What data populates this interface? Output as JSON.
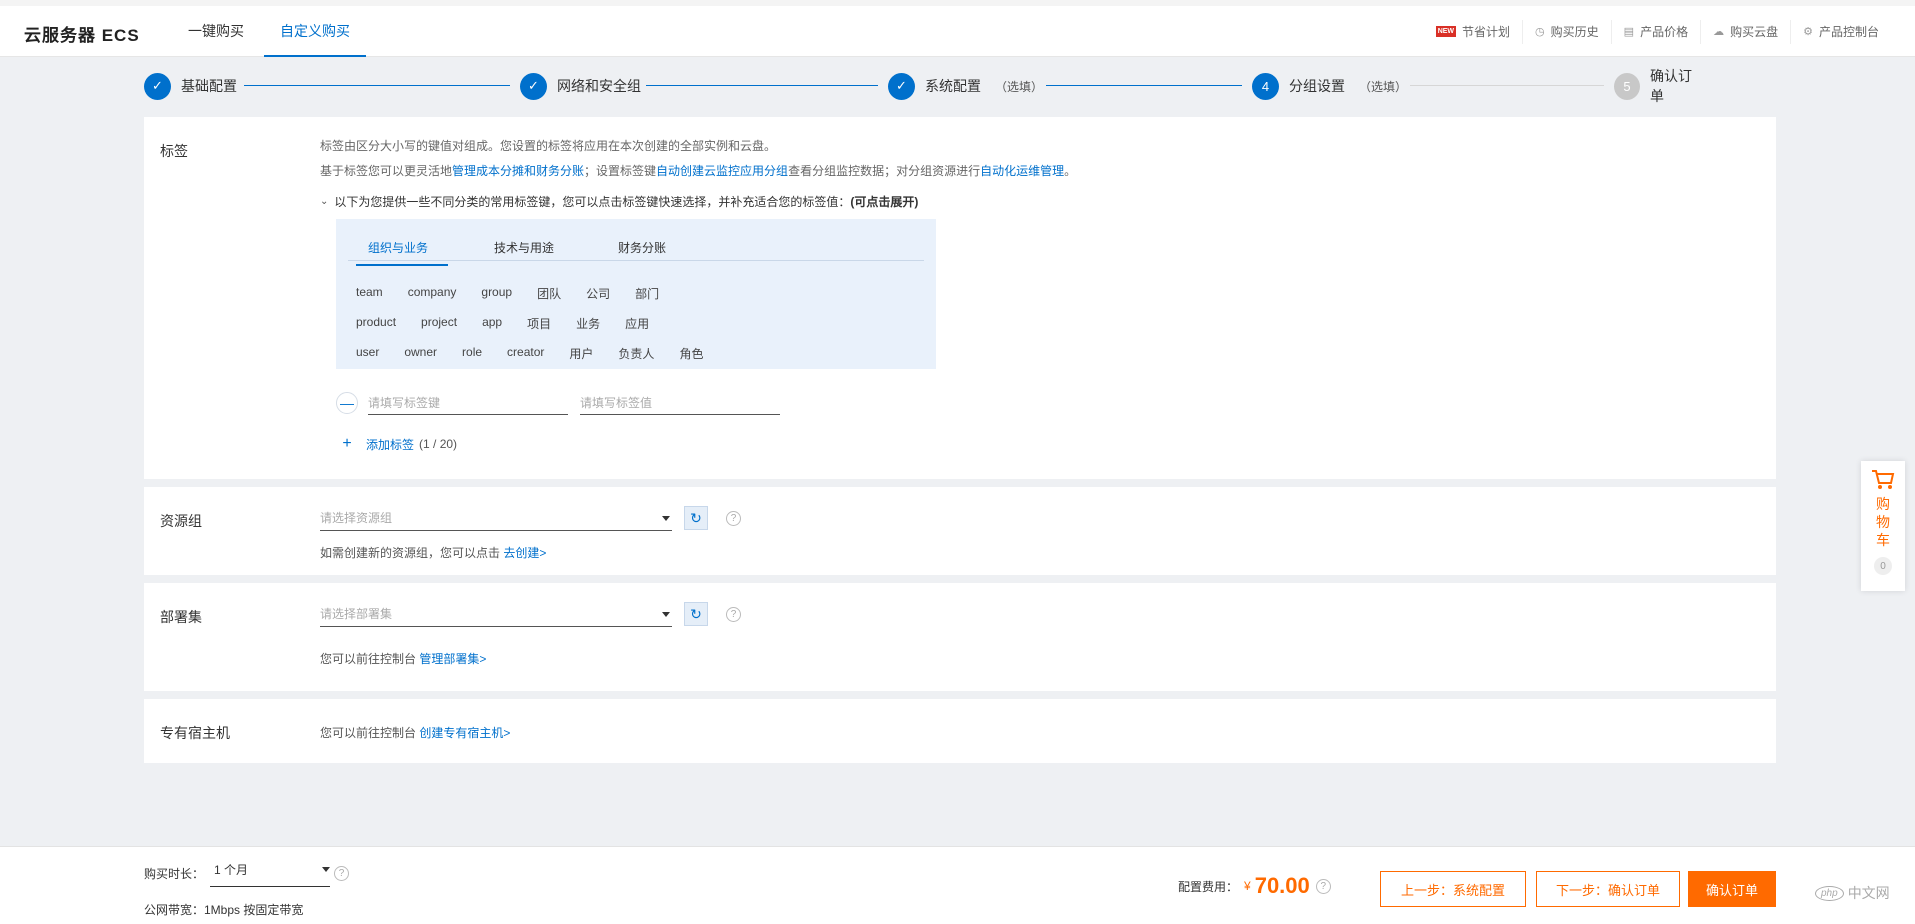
{
  "header": {
    "brand": "云服务器 ECS",
    "tabs": [
      "一键购买",
      "自定义购买"
    ],
    "right_items": [
      {
        "label": "节省计划",
        "badge": "NEW"
      },
      {
        "label": "购买历史"
      },
      {
        "label": "产品价格"
      },
      {
        "label": "购买云盘"
      },
      {
        "label": "产品控制台"
      }
    ]
  },
  "steps": [
    {
      "num": "✓",
      "label": "基础配置",
      "optional": ""
    },
    {
      "num": "✓",
      "label": "网络和安全组",
      "optional": ""
    },
    {
      "num": "✓",
      "label": "系统配置",
      "optional": "（选填）"
    },
    {
      "num": "4",
      "label": "分组设置",
      "optional": "（选填）"
    },
    {
      "num": "5",
      "label": "确认订单",
      "optional": ""
    }
  ],
  "tags": {
    "title": "标签",
    "desc1": "标签由区分大小写的键值对组成。您设置的标签将应用在本次创建的全部实例和云盘。",
    "desc2_pre": "基于标签您可以更灵活地",
    "desc2_link1": "管理成本分摊和财务分账",
    "desc2_mid1": "；设置标签键",
    "desc2_link2": "自动创建云监控应用分组",
    "desc2_mid2": "查看分组监控数据；对分组资源进行",
    "desc2_link3": "自动化运维管理",
    "desc2_end": "。",
    "expander_text": "以下为您提供一些不同分类的常用标签键，您可以点击标签键快速选择，并补充适合您的标签值：",
    "expander_bold": "(可点击展开)",
    "panel_tabs": [
      "组织与业务",
      "技术与用途",
      "财务分账"
    ],
    "chip_rows": [
      [
        "team",
        "company",
        "group",
        "团队",
        "公司",
        "部门"
      ],
      [
        "product",
        "project",
        "app",
        "项目",
        "业务",
        "应用"
      ],
      [
        "user",
        "owner",
        "role",
        "creator",
        "用户",
        "负责人",
        "角色"
      ]
    ],
    "key_placeholder": "请填写标签键",
    "value_placeholder": "请填写标签值",
    "add_label": "添加标签",
    "add_count": "(1 / 20)"
  },
  "resource_group": {
    "title": "资源组",
    "placeholder": "请选择资源组",
    "hint_pre": "如需创建新的资源组，您可以点击 ",
    "hint_link": "去创建>"
  },
  "deploy_set": {
    "title": "部署集",
    "placeholder": "请选择部署集",
    "hint_pre": "您可以前往控制台 ",
    "hint_link": "管理部署集>"
  },
  "dedicated_host": {
    "title": "专有宿主机",
    "hint_pre": "您可以前往控制台 ",
    "hint_link": "创建专有宿主机>"
  },
  "cart": {
    "label": "购物车",
    "count": "0"
  },
  "bottom": {
    "duration_label": "购买时长：",
    "duration_value": "1 个月",
    "bandwidth": "公网带宽：1Mbps 按固定带宽",
    "fee_label": "配置费用：",
    "currency": "¥",
    "price": "70.00",
    "prev_btn": "上一步：系统配置",
    "next_btn": "下一步：确认订单",
    "confirm_btn": "确认订单",
    "watermark": "中文网",
    "watermark_logo": "php"
  },
  "colors": {
    "accent": "#0070cc",
    "orange": "#ff6a00"
  }
}
